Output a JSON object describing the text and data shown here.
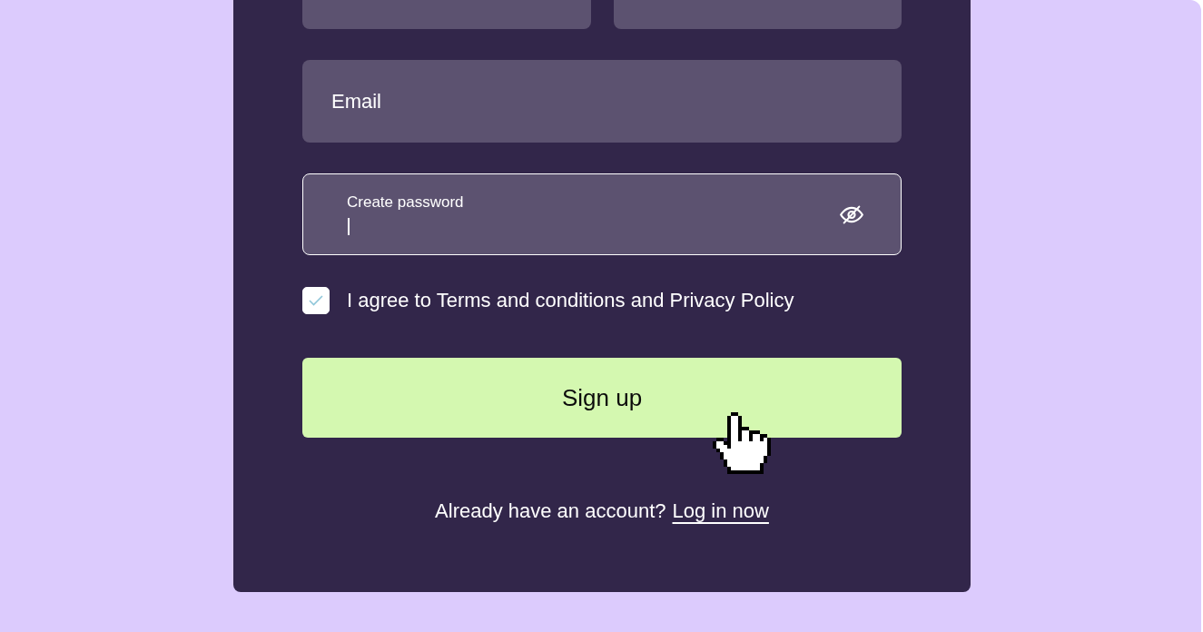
{
  "top_row_fields": [
    {
      "kind": "input"
    },
    {
      "kind": "input"
    }
  ],
  "email_field": {
    "placeholder": "Email"
  },
  "password_field": {
    "label": "Create password",
    "focused": true
  },
  "terms": {
    "checked": true,
    "text": "I agree to Terms and conditions and Privacy Policy"
  },
  "signup_button": {
    "label": "Sign up",
    "hovered": true
  },
  "footer": {
    "text": "Already have an account?",
    "link": "Log in now"
  }
}
